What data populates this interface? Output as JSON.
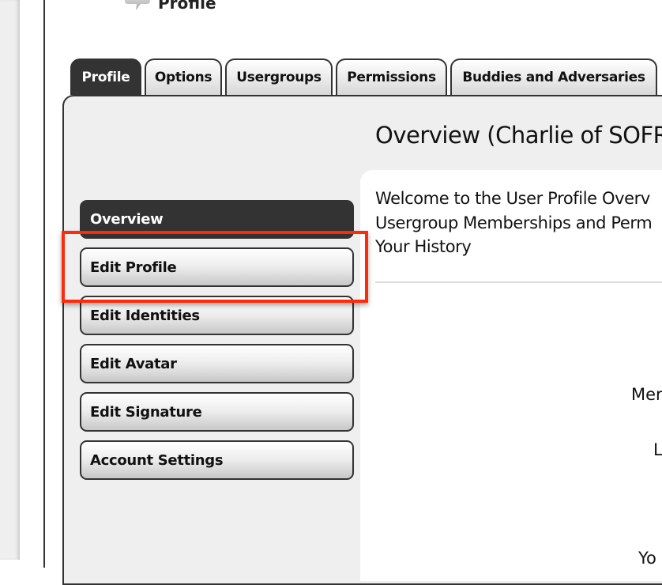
{
  "page": {
    "heading": "Profile",
    "heading_icon": "speech-bubble-icon"
  },
  "tabs": [
    {
      "label": "Profile",
      "active": true
    },
    {
      "label": "Options",
      "active": false
    },
    {
      "label": "Usergroups",
      "active": false
    },
    {
      "label": "Permissions",
      "active": false
    },
    {
      "label": "Buddies and Adversaries",
      "active": false
    }
  ],
  "side_nav": [
    {
      "label": "Overview",
      "active": true
    },
    {
      "label": "Edit Profile",
      "active": false,
      "highlighted": true
    },
    {
      "label": "Edit Identities",
      "active": false
    },
    {
      "label": "Edit Avatar",
      "active": false
    },
    {
      "label": "Edit Signature",
      "active": false
    },
    {
      "label": "Account Settings",
      "active": false
    }
  ],
  "content": {
    "title": "Overview (Charlie of SOFRE",
    "welcome_lines": [
      "Welcome to the User Profile Overv",
      "Usergroup Memberships and Perm",
      "Your History"
    ],
    "stat_labels": [
      "Mer",
      "L",
      "Yo"
    ]
  },
  "annotation": {
    "highlight_color": "#ff2a0a",
    "highlight_target": "Edit Profile"
  }
}
